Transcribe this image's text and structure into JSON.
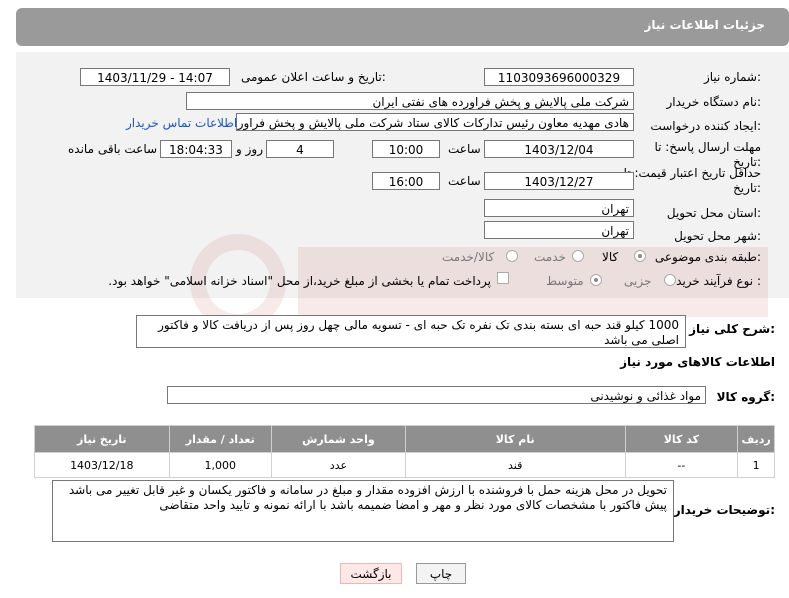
{
  "header": {
    "title": "جزئیات اطلاعات نیاز"
  },
  "form": {
    "need_number_label": "شماره نیاز:",
    "need_number": "1103093696000329",
    "announce_label": "تاریخ و ساعت اعلان عمومی:",
    "announce_value": "1403/11/29 - 14:07",
    "buyer_org_label": "نام دستگاه خریدار:",
    "buyer_org": "شرکت ملی پالایش و پخش فراورده های نفتی ایران",
    "creator_label": "ایجاد کننده درخواست:",
    "creator": "هادی مهدیه معاون رئیس تدارکات کالای ستاد شرکت ملی پالایش و پخش فراورد",
    "contact_link": "اطلاعات تماس خریدار",
    "deadline_label": "مهلت ارسال پاسخ: تا",
    "deadline_label2": "تاریخ:",
    "deadline_date": "1403/12/04",
    "time_word": "ساعت",
    "deadline_time": "10:00",
    "days_value": "4",
    "days_word": "روز و",
    "remaining_time": "18:04:33",
    "remaining_word": "ساعت باقی مانده",
    "validity_label": "حداقل تاریخ اعتبار قیمت: تا",
    "validity_label2": "تاریخ:",
    "validity_date": "1403/12/27",
    "validity_time": "16:00",
    "province_label": "استان محل تحویل:",
    "province": "تهران",
    "city_label": "شهر محل تحویل:",
    "city": "تهران",
    "category_label": "طبقه بندی موضوعی:",
    "category_options": [
      "کالا",
      "خدمت",
      "کالا/خدمت"
    ],
    "purchase_label": "نوع فرآیند خرید :",
    "purchase_options": [
      "جزیی",
      "متوسط"
    ],
    "purchase_note": "پرداخت تمام یا بخشی از مبلغ خرید،از محل \"اسناد خزانه اسلامی\" خواهد بود."
  },
  "summary": {
    "label": "شرح کلی نیاز:",
    "text": "1000 کیلو قند حبه ای بسته بندی تک نفره  تک حبه ای - تسویه مالی چهل روز پس از دریافت کالا و فاکتور اصلی می باشد"
  },
  "goods": {
    "section_title": "اطلاعات کالاهای مورد نیاز",
    "group_label": "گروه کالا:",
    "group_value": "مواد غذائی و نوشیدنی"
  },
  "table": {
    "headers": [
      "ردیف",
      "کد کالا",
      "نام کالا",
      "واحد شمارش",
      "تعداد / مقدار",
      "تاریخ نیاز"
    ],
    "rows": [
      [
        "1",
        "--",
        "قند",
        "عدد",
        "1,000",
        "1403/12/18"
      ]
    ]
  },
  "buyer_notes": {
    "label": "توضیحات خریدار:",
    "text": "تحویل در محل هزینه حمل با فروشنده با ارزش افزوده مقدار و مبلغ در سامانه و فاکتور یکسان و غیر قابل تغییر می باشد پیش فاکتور با مشخصات کالای مورد نظر و مهر و امضا ضمیمه باشد با ارائه نمونه و تایید واحد متقاضی"
  },
  "buttons": {
    "print": "چاپ",
    "back": "بازگشت"
  },
  "colors": {
    "header_bg": "#9a9a9a",
    "panel_bg": "#f2f2f2",
    "link": "#1a57c9",
    "table_header": "#8f8f8f"
  }
}
